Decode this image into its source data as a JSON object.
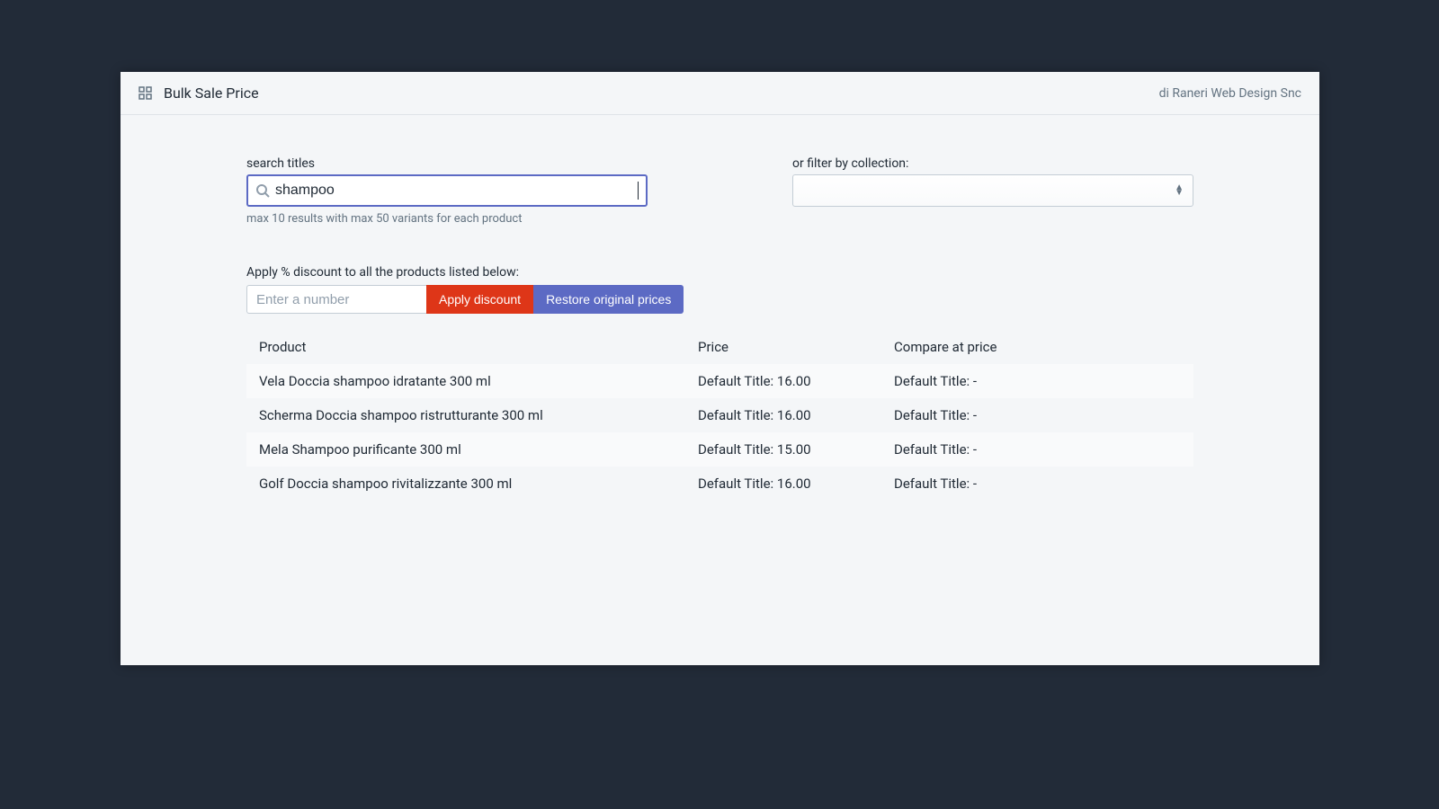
{
  "header": {
    "title": "Bulk Sale Price",
    "meta": "di Raneri Web Design Snc"
  },
  "filters": {
    "search_label": "search titles",
    "search_value": "shampoo",
    "search_hint": "max 10 results with max 50 variants for each product",
    "collection_label": "or filter by collection:"
  },
  "discount": {
    "label": "Apply % discount to all the products listed below:",
    "placeholder": "Enter a number",
    "apply_label": "Apply discount",
    "restore_label": "Restore original prices"
  },
  "table": {
    "headers": {
      "product": "Product",
      "price": "Price",
      "compare": "Compare at price"
    },
    "rows": [
      {
        "product": "Vela Doccia shampoo idratante 300 ml",
        "price": "Default Title: 16.00",
        "compare": "Default Title: -"
      },
      {
        "product": "Scherma Doccia shampoo ristrutturante 300 ml",
        "price": "Default Title: 16.00",
        "compare": "Default Title: -"
      },
      {
        "product": "Mela Shampoo purificante 300 ml",
        "price": "Default Title: 15.00",
        "compare": "Default Title: -"
      },
      {
        "product": "Golf Doccia shampoo rivitalizzante 300 ml",
        "price": "Default Title: 16.00",
        "compare": "Default Title: -"
      }
    ]
  }
}
